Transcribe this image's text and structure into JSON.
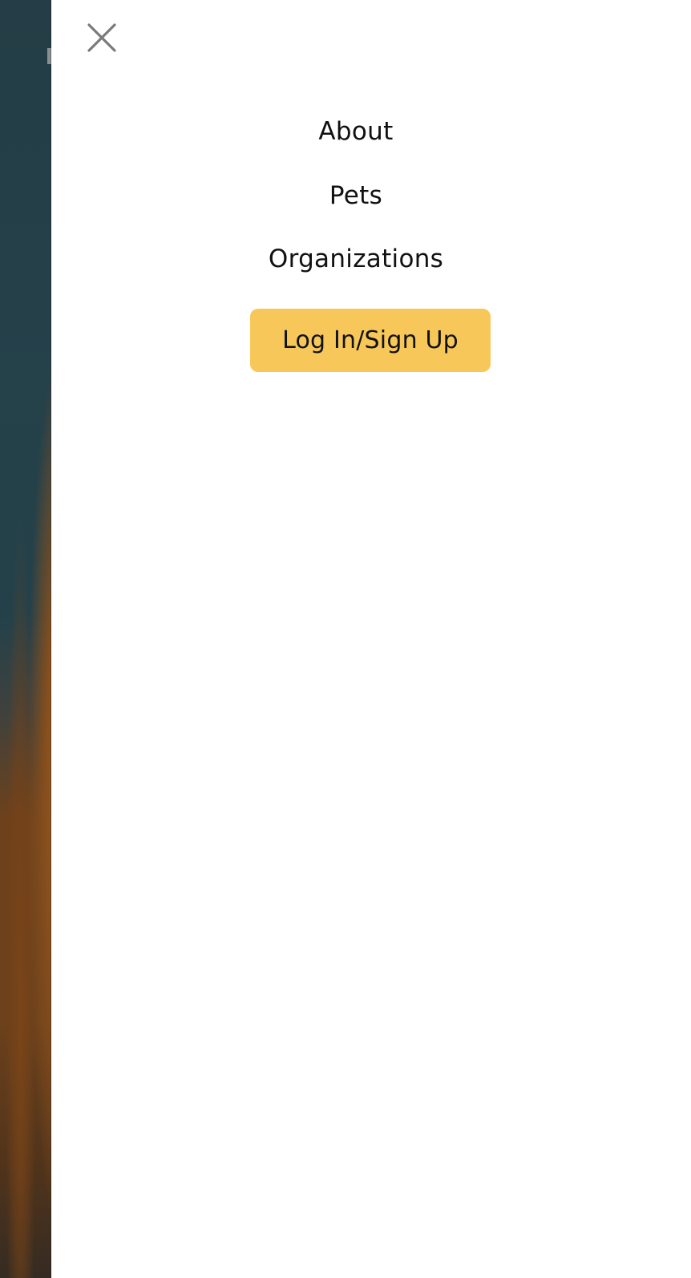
{
  "theme": {
    "accent": "#F7C75A",
    "drawer_bg": "#FFFFFF",
    "text": "#111111",
    "close_icon_color": "#7A7A7A"
  },
  "drawer": {
    "close_icon": "close-icon",
    "nav": {
      "items": [
        {
          "label": "About"
        },
        {
          "label": "Pets"
        },
        {
          "label": "Organizations"
        }
      ],
      "login_label": "Log In/Sign Up"
    }
  }
}
